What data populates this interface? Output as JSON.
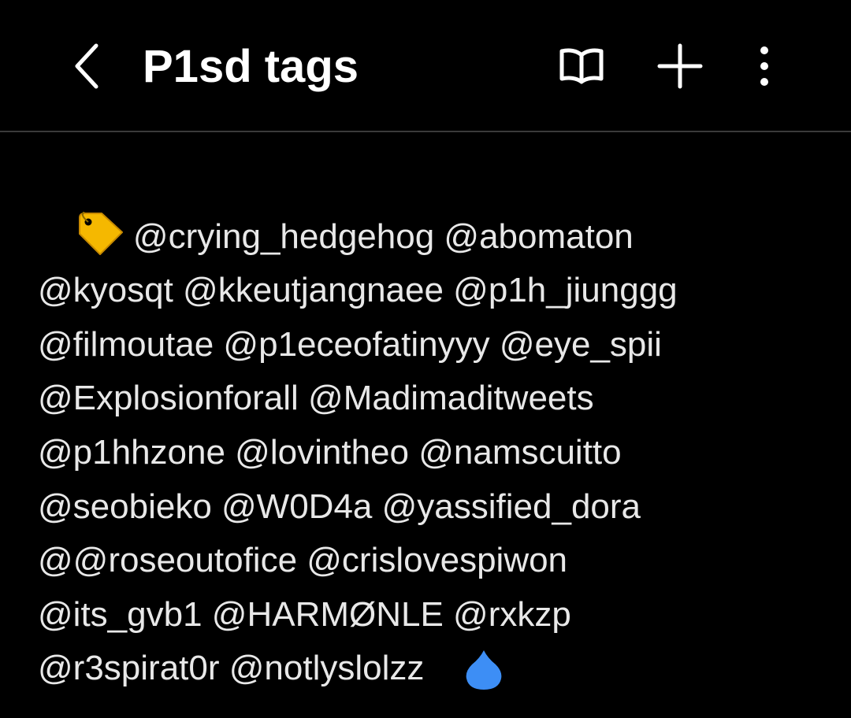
{
  "header": {
    "title": "P1sd tags",
    "back_icon": "chevron-left-icon",
    "reader_icon": "open-book-icon",
    "add_icon": "plus-icon",
    "more_icon": "more-vertical-icon"
  },
  "note": {
    "lead_icon": "label-tag-emoji",
    "lines": [
      "@crying_hedgehog @abomaton",
      "@kyosqt @kkeutjangnaee @p1h_jiunggg",
      "@filmoutae @p1eceofatinyyy @eye_spii",
      "@Explosionforall @Madimaditweets",
      "@p1hhzone @lovintheo @namscuitto",
      "@seobieko @W0D4a @yassified_dora",
      "@@roseoutofice @crislovespiwon",
      "@its_gvb1 @HARMØNLE @rxkzp",
      "@r3spirat0r @notlyslolzz"
    ]
  },
  "colors": {
    "background": "#000000",
    "text": "#e8e8e8",
    "title": "#ffffff",
    "divider": "#3a3a3a",
    "cursor_handle": "#3d8ef5",
    "tag_emoji": "#f5b800"
  }
}
